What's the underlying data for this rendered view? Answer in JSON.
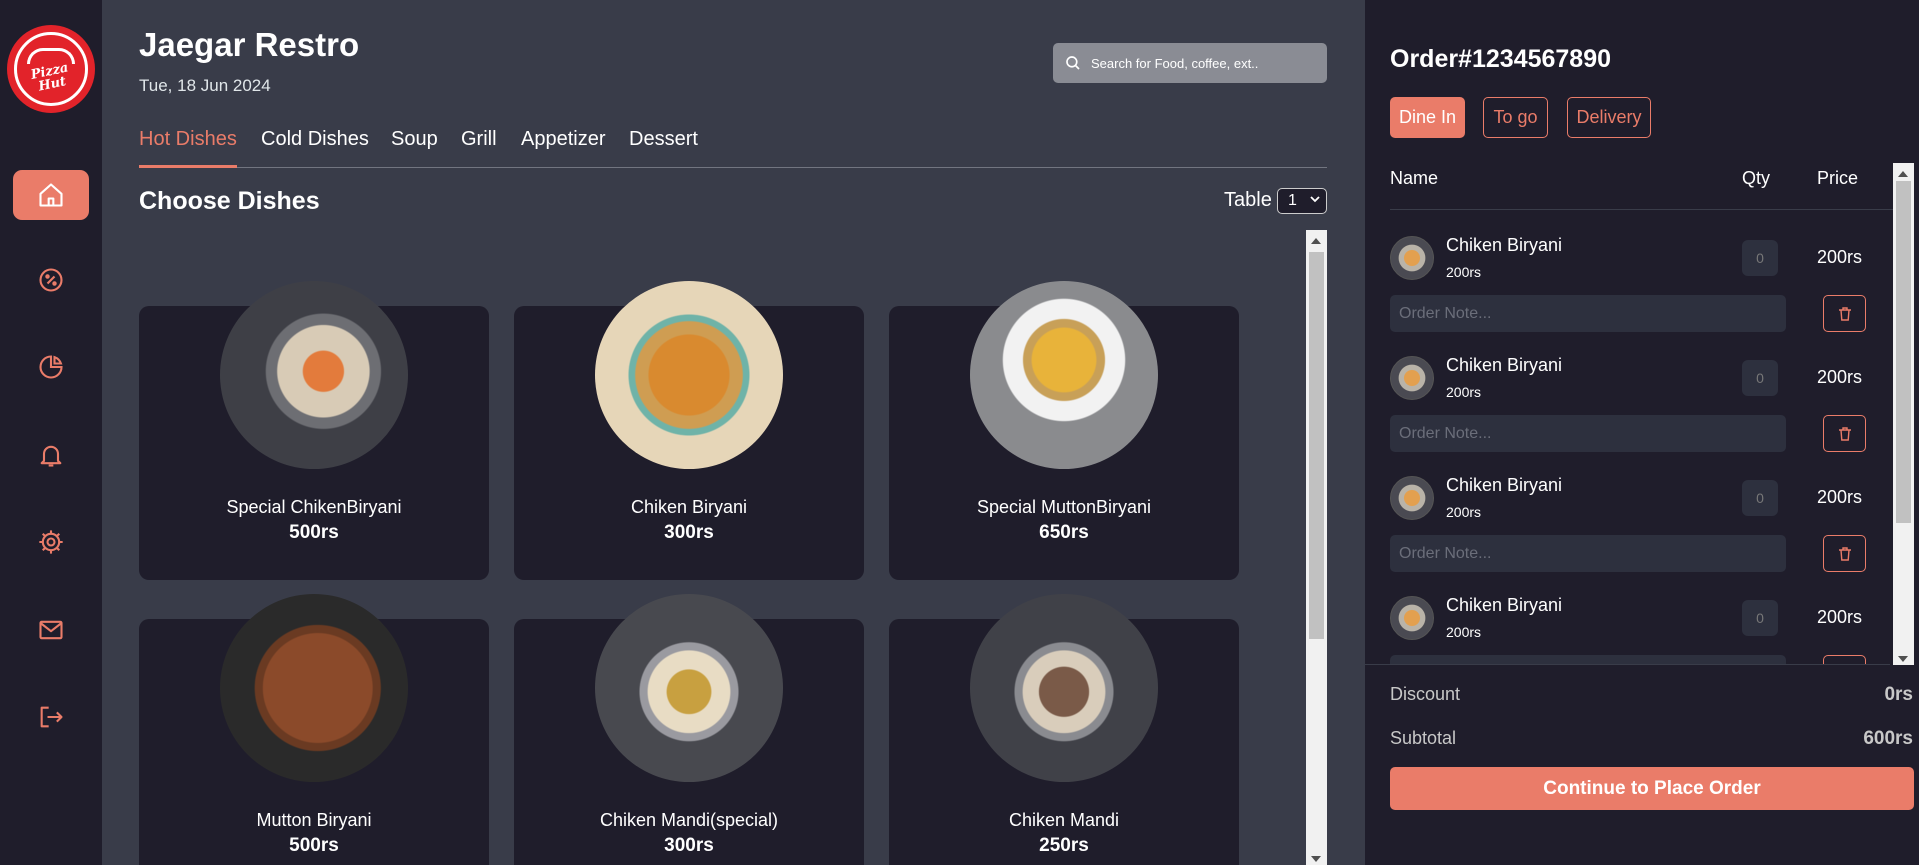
{
  "brand": {
    "logo_text": "Pizza Hut",
    "accent": "#ea7c69"
  },
  "sidebar": {
    "items": [
      {
        "icon": "home-icon",
        "active": true
      },
      {
        "icon": "discount-icon"
      },
      {
        "icon": "pie-chart-icon"
      },
      {
        "icon": "bell-icon"
      },
      {
        "icon": "gear-icon"
      },
      {
        "icon": "mail-icon"
      },
      {
        "icon": "logout-icon"
      }
    ]
  },
  "header": {
    "title": "Jaegar Restro",
    "date": "Tue, 18 Jun 2024",
    "search_placeholder": "Search for Food, coffee, ext.."
  },
  "tabs": [
    "Hot Dishes",
    "Cold Dishes",
    "Soup",
    "Grill",
    "Appetizer",
    "Dessert"
  ],
  "dishes_section": {
    "title": "Choose Dishes",
    "table_label": "Table",
    "table_value": "1"
  },
  "dishes": [
    {
      "name": "Special ChikenBiryani",
      "price": "500rs"
    },
    {
      "name": "Chiken Biryani",
      "price": "300rs"
    },
    {
      "name": "Special MuttonBiryani",
      "price": "650rs"
    },
    {
      "name": "Mutton Biryani",
      "price": "500rs"
    },
    {
      "name": "Chiken Mandi(special)",
      "price": "300rs"
    },
    {
      "name": "Chiken Mandi",
      "price": "250rs"
    }
  ],
  "order": {
    "title": "Order#1234567890",
    "types": [
      "Dine In",
      "To go",
      "Delivery"
    ],
    "active_type": "Dine In",
    "columns": {
      "name": "Name",
      "qty": "Qty",
      "price": "Price"
    },
    "note_placeholder": "Order Note...",
    "items": [
      {
        "name": "Chiken Biryani",
        "unit_price": "200rs",
        "qty": "0",
        "total": "200rs"
      },
      {
        "name": "Chiken Biryani",
        "unit_price": "200rs",
        "qty": "0",
        "total": "200rs"
      },
      {
        "name": "Chiken Biryani",
        "unit_price": "200rs",
        "qty": "0",
        "total": "200rs"
      },
      {
        "name": "Chiken Biryani",
        "unit_price": "200rs",
        "qty": "0",
        "total": "200rs"
      }
    ],
    "discount_label": "Discount",
    "discount_value": "0rs",
    "subtotal_label": "Subtotal",
    "subtotal_value": "600rs",
    "place_order_label": "Continue to Place Order"
  }
}
